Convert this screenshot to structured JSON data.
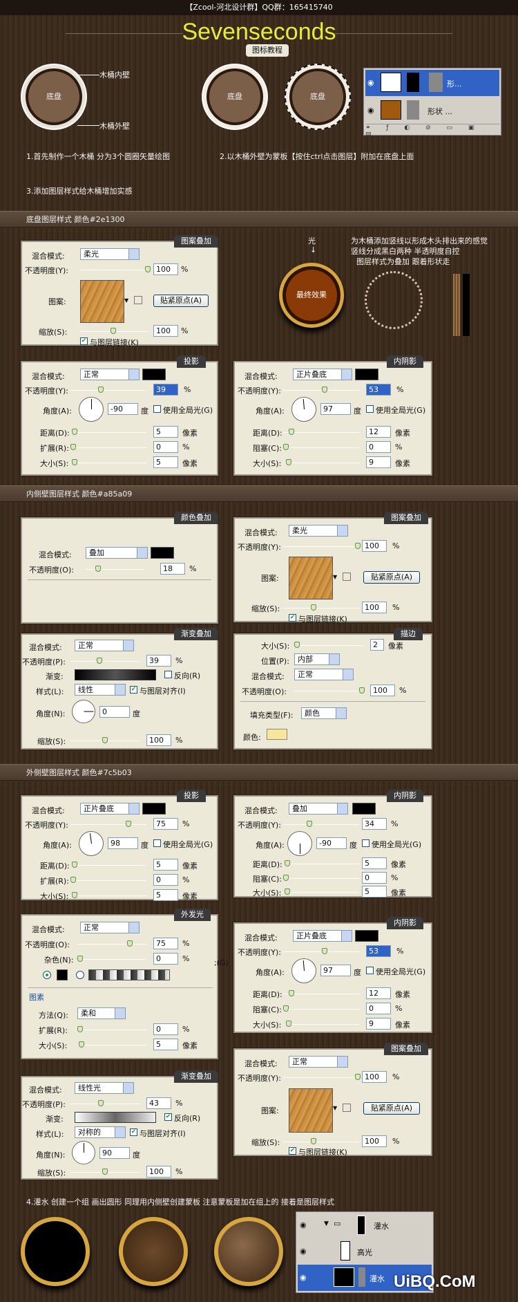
{
  "header": {
    "title": "【Zcool-河北设计群】QQ群：165415740",
    "logo": "Sevenseconds",
    "subtitle": "图标教程"
  },
  "intro": {
    "inner_wall": "木桶内壁",
    "outer_wall": "木桶外壁",
    "base": "底盘",
    "base2": "底盘",
    "base3": "底盘",
    "step1": "1.首先制作一个木桶 分为3个圆圈矢量绘图",
    "step2": "2.以木桶外壁为蒙板【按住ctrl点击图层】附加在底盘上面",
    "step3": "3.添加图层样式给木桶增加实感",
    "layers": {
      "layer1": "形...",
      "layer2": "形状 ..."
    }
  },
  "common": {
    "blend": "混合模式:",
    "opacity": "不透明度(Y):",
    "opacity_o": "不透明度(O):",
    "opacity_p": "不透明度(P):",
    "pattern": "图案:",
    "snap": "贴紧原点(A)",
    "scale": "缩放(S):",
    "link": "与图层链接(K)",
    "angle": "角度(A):",
    "deg": "度",
    "global": "使用全局光(G)",
    "distance": "距离(D):",
    "spread": "扩展(R):",
    "choke": "阻塞(C):",
    "size": "大小(S):",
    "px": "像素",
    "pct": "%"
  },
  "section1": {
    "title": "底盘图层样式  颜色#2e1300",
    "pattern": {
      "tab": "图案叠加",
      "mode": "柔光",
      "opacity": "100",
      "scale": "100"
    },
    "shadow": {
      "tab": "投影",
      "mode": "正常",
      "opacity": "39",
      "angle": "-90",
      "distance": "5",
      "spread": "0",
      "size": "5"
    },
    "inner": {
      "tab": "内阴影",
      "mode": "正片叠底",
      "opacity": "53",
      "angle": "97",
      "distance": "12",
      "choke": "0",
      "size": "9"
    },
    "light": "光",
    "final": "最终效果",
    "desc1": "为木桶添加竖线以形成木头排出来的感觉",
    "desc2": "竖线分成黑白两种 半透明度自控",
    "desc3": "图层样式为叠加 跟着形状走"
  },
  "section2": {
    "title": "内侧壁图层样式  颜色#a85a09",
    "color": {
      "tab": "颜色叠加",
      "mode": "叠加",
      "opacity": "18"
    },
    "pattern": {
      "tab": "图案叠加",
      "mode": "柔光",
      "opacity": "100",
      "scale": "100"
    },
    "gradient": {
      "tab": "渐变叠加",
      "mode": "正常",
      "opacity": "39",
      "grad": "渐变:",
      "reverse": "反向(R)",
      "style_l": "样式(L):",
      "style": "线性",
      "align": "与图层对齐(I)",
      "angle_n": "角度(N):",
      "angle": "0",
      "scale": "100"
    },
    "stroke": {
      "tab": "描边",
      "size": "2",
      "pos_l": "位置(P):",
      "pos": "内部",
      "mode": "正常",
      "opacity": "100",
      "fill_l": "填充类型(F):",
      "fill": "颜色",
      "color_l": "颜色:",
      "color": "#f8e79a"
    }
  },
  "section3": {
    "title": "外侧壁图层样式  颜色#7c5b03",
    "shadow": {
      "tab": "投影",
      "mode": "正片叠底",
      "opacity": "75",
      "angle": "98",
      "distance": "5",
      "spread": "0",
      "size": "5"
    },
    "inner": {
      "tab": "内阴影",
      "mode": "叠加",
      "opacity": "34",
      "angle": "-90",
      "distance": "5",
      "choke": "0",
      "size": "5"
    },
    "glow": {
      "tab": "外发光",
      "mode": "正常",
      "opacity": "75",
      "noise_l": "杂色(N):",
      "noise": "0",
      "sec": "图素",
      "method_l": "方法(Q):",
      "method": "柔和",
      "spread": "0",
      "size": "5",
      "side": ";(G)"
    },
    "inner2": {
      "tab": "内阴影",
      "mode": "正片叠底",
      "opacity": "53",
      "angle": "97",
      "distance": "12",
      "choke": "0",
      "size": "9"
    },
    "gradient": {
      "tab": "渐变叠加",
      "mode": "线性光",
      "opacity": "43",
      "reverse": "反向(R)",
      "style": "对称的",
      "angle": "90",
      "scale": "100"
    },
    "pattern": {
      "tab": "图案叠加",
      "mode": "正常",
      "opacity": "100",
      "scale": "100"
    }
  },
  "section4": {
    "title": "4.灌水 创建一个组 画出圆形 同理用内侧壁创建蒙板 注意蒙板是加在组上的 接着是图层样式",
    "layers": {
      "group": "灌水",
      "l1": "高光",
      "l2": "灌水"
    },
    "watermark": "UiBQ.CoM"
  },
  "colors": {
    "accent": "#e6ec3a",
    "panel": "#ece9d8",
    "selection": "#3163c6"
  }
}
